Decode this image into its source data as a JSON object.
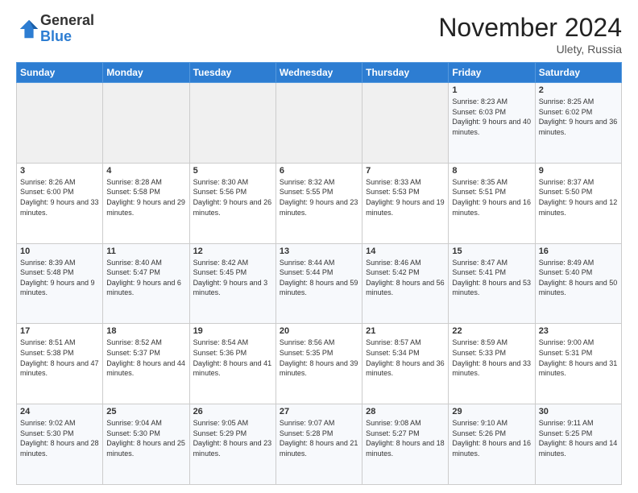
{
  "logo": {
    "general": "General",
    "blue": "Blue"
  },
  "header": {
    "month": "November 2024",
    "location": "Ulety, Russia"
  },
  "weekdays": [
    "Sunday",
    "Monday",
    "Tuesday",
    "Wednesday",
    "Thursday",
    "Friday",
    "Saturday"
  ],
  "weeks": [
    [
      {
        "day": "",
        "info": ""
      },
      {
        "day": "",
        "info": ""
      },
      {
        "day": "",
        "info": ""
      },
      {
        "day": "",
        "info": ""
      },
      {
        "day": "",
        "info": ""
      },
      {
        "day": "1",
        "info": "Sunrise: 8:23 AM\nSunset: 6:03 PM\nDaylight: 9 hours and 40 minutes."
      },
      {
        "day": "2",
        "info": "Sunrise: 8:25 AM\nSunset: 6:02 PM\nDaylight: 9 hours and 36 minutes."
      }
    ],
    [
      {
        "day": "3",
        "info": "Sunrise: 8:26 AM\nSunset: 6:00 PM\nDaylight: 9 hours and 33 minutes."
      },
      {
        "day": "4",
        "info": "Sunrise: 8:28 AM\nSunset: 5:58 PM\nDaylight: 9 hours and 29 minutes."
      },
      {
        "day": "5",
        "info": "Sunrise: 8:30 AM\nSunset: 5:56 PM\nDaylight: 9 hours and 26 minutes."
      },
      {
        "day": "6",
        "info": "Sunrise: 8:32 AM\nSunset: 5:55 PM\nDaylight: 9 hours and 23 minutes."
      },
      {
        "day": "7",
        "info": "Sunrise: 8:33 AM\nSunset: 5:53 PM\nDaylight: 9 hours and 19 minutes."
      },
      {
        "day": "8",
        "info": "Sunrise: 8:35 AM\nSunset: 5:51 PM\nDaylight: 9 hours and 16 minutes."
      },
      {
        "day": "9",
        "info": "Sunrise: 8:37 AM\nSunset: 5:50 PM\nDaylight: 9 hours and 12 minutes."
      }
    ],
    [
      {
        "day": "10",
        "info": "Sunrise: 8:39 AM\nSunset: 5:48 PM\nDaylight: 9 hours and 9 minutes."
      },
      {
        "day": "11",
        "info": "Sunrise: 8:40 AM\nSunset: 5:47 PM\nDaylight: 9 hours and 6 minutes."
      },
      {
        "day": "12",
        "info": "Sunrise: 8:42 AM\nSunset: 5:45 PM\nDaylight: 9 hours and 3 minutes."
      },
      {
        "day": "13",
        "info": "Sunrise: 8:44 AM\nSunset: 5:44 PM\nDaylight: 8 hours and 59 minutes."
      },
      {
        "day": "14",
        "info": "Sunrise: 8:46 AM\nSunset: 5:42 PM\nDaylight: 8 hours and 56 minutes."
      },
      {
        "day": "15",
        "info": "Sunrise: 8:47 AM\nSunset: 5:41 PM\nDaylight: 8 hours and 53 minutes."
      },
      {
        "day": "16",
        "info": "Sunrise: 8:49 AM\nSunset: 5:40 PM\nDaylight: 8 hours and 50 minutes."
      }
    ],
    [
      {
        "day": "17",
        "info": "Sunrise: 8:51 AM\nSunset: 5:38 PM\nDaylight: 8 hours and 47 minutes."
      },
      {
        "day": "18",
        "info": "Sunrise: 8:52 AM\nSunset: 5:37 PM\nDaylight: 8 hours and 44 minutes."
      },
      {
        "day": "19",
        "info": "Sunrise: 8:54 AM\nSunset: 5:36 PM\nDaylight: 8 hours and 41 minutes."
      },
      {
        "day": "20",
        "info": "Sunrise: 8:56 AM\nSunset: 5:35 PM\nDaylight: 8 hours and 39 minutes."
      },
      {
        "day": "21",
        "info": "Sunrise: 8:57 AM\nSunset: 5:34 PM\nDaylight: 8 hours and 36 minutes."
      },
      {
        "day": "22",
        "info": "Sunrise: 8:59 AM\nSunset: 5:33 PM\nDaylight: 8 hours and 33 minutes."
      },
      {
        "day": "23",
        "info": "Sunrise: 9:00 AM\nSunset: 5:31 PM\nDaylight: 8 hours and 31 minutes."
      }
    ],
    [
      {
        "day": "24",
        "info": "Sunrise: 9:02 AM\nSunset: 5:30 PM\nDaylight: 8 hours and 28 minutes."
      },
      {
        "day": "25",
        "info": "Sunrise: 9:04 AM\nSunset: 5:30 PM\nDaylight: 8 hours and 25 minutes."
      },
      {
        "day": "26",
        "info": "Sunrise: 9:05 AM\nSunset: 5:29 PM\nDaylight: 8 hours and 23 minutes."
      },
      {
        "day": "27",
        "info": "Sunrise: 9:07 AM\nSunset: 5:28 PM\nDaylight: 8 hours and 21 minutes."
      },
      {
        "day": "28",
        "info": "Sunrise: 9:08 AM\nSunset: 5:27 PM\nDaylight: 8 hours and 18 minutes."
      },
      {
        "day": "29",
        "info": "Sunrise: 9:10 AM\nSunset: 5:26 PM\nDaylight: 8 hours and 16 minutes."
      },
      {
        "day": "30",
        "info": "Sunrise: 9:11 AM\nSunset: 5:25 PM\nDaylight: 8 hours and 14 minutes."
      }
    ]
  ]
}
